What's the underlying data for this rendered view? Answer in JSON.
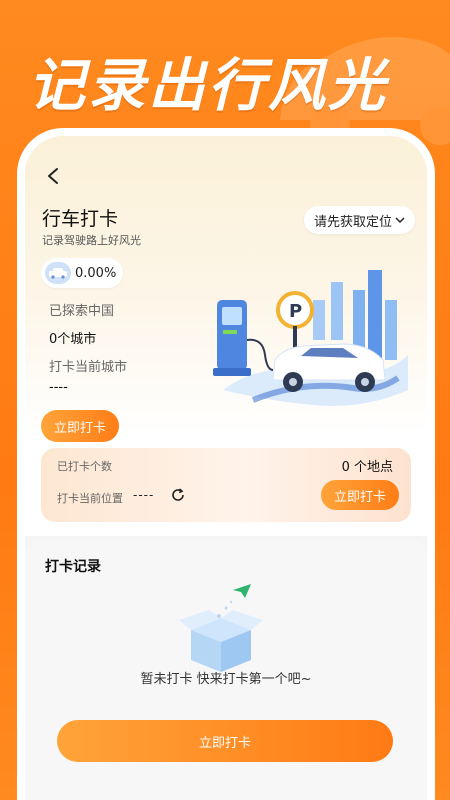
{
  "promo": {
    "headline": "记录出行风光"
  },
  "header": {
    "title": "行车打卡",
    "subtitle": "记录驾驶路上好风光",
    "location_label": "请先获取定位"
  },
  "stats": {
    "explored_percent": "0.00%",
    "explored_label": "已探索中国",
    "city_count": "0个城市",
    "current_city_label": "打卡当前城市",
    "current_city_value": "----",
    "checkin_button": "立即打卡"
  },
  "count_card": {
    "count_label": "已打卡个数",
    "count_value": "0 个地点",
    "position_label": "打卡当前位置",
    "position_value": "----",
    "checkin_button": "立即打卡"
  },
  "records": {
    "title": "打卡记录",
    "empty_text": "暂未打卡 快来打卡第一个吧~",
    "checkin_button": "立即打卡"
  },
  "colors": {
    "brand_orange": "#ff7d16",
    "light_orange": "#ffa43a",
    "background_orange": "#ff8a1f"
  },
  "icons": [
    "back-arrow-icon",
    "chevron-down-icon",
    "car-icon",
    "refresh-icon",
    "ev-charging-illustration",
    "empty-box-illustration"
  ]
}
